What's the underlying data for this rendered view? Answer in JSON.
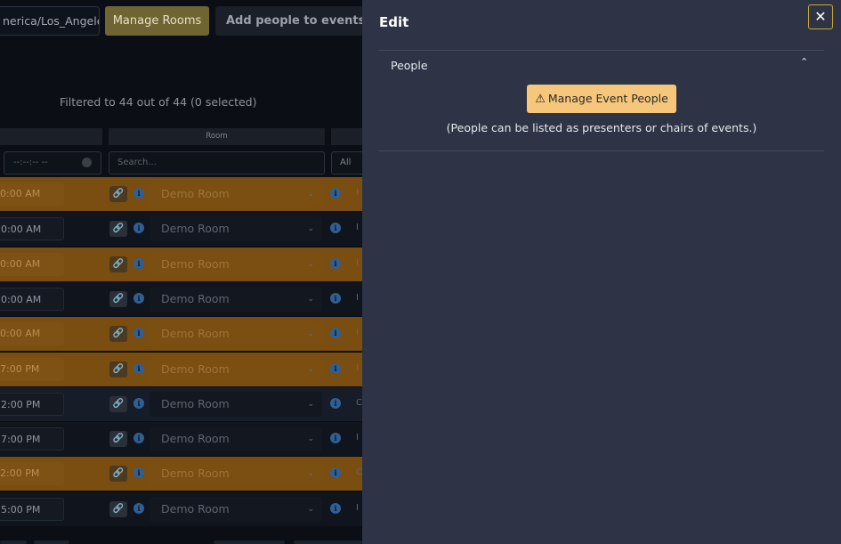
{
  "background": {
    "timezone": "nerica/Los_Angeles",
    "manage_rooms_label": "Manage Rooms",
    "add_people_label": "Add people to events (batch",
    "filtered_text": "Filtered to 44 out of 44 (0 selected)",
    "room_column_header": "Room",
    "time_filter_placeholder": "--:--:-- --",
    "search_placeholder": "Search...",
    "filter_all": "All",
    "rows": [
      {
        "time": "0:00 AM",
        "room": "Demo Room",
        "tail": "I"
      },
      {
        "time": "0:00 AM",
        "room": "Demo Room",
        "tail": "I"
      },
      {
        "time": "0:00 AM",
        "room": "Demo Room",
        "tail": "I"
      },
      {
        "time": "0:00 AM",
        "room": "Demo Room",
        "tail": "I"
      },
      {
        "time": "0:00 AM",
        "room": "Demo Room",
        "tail": "I"
      },
      {
        "time": "7:00 PM",
        "room": "Demo Room",
        "tail": "I"
      },
      {
        "time": "2:00 PM",
        "room": "Demo Room",
        "tail": "C"
      },
      {
        "time": "7:00 PM",
        "room": "Demo Room",
        "tail": "I"
      },
      {
        "time": "2:00 PM",
        "room": "Demo Room",
        "tail": "C"
      },
      {
        "time": "5:00 PM",
        "room": "Demo Room",
        "tail": "I"
      }
    ]
  },
  "panel": {
    "title": "Edit",
    "close_symbol": "✕",
    "section_label": "People",
    "collapse_symbol": "⌃",
    "manage_people_label": "Manage Event People",
    "warning_symbol": "⚠",
    "note": "(People can be listed as presenters or chairs of events.)"
  },
  "icons": {
    "link": "link-icon",
    "info": "info-icon",
    "chevron": "chevron-down-icon",
    "warning": "warning-icon",
    "close": "close-icon"
  },
  "colors": {
    "panel_bg": "#2e3445",
    "accent_button": "#f6c77a",
    "close_border": "#c9a733",
    "row_orange": "#7a4d10"
  }
}
